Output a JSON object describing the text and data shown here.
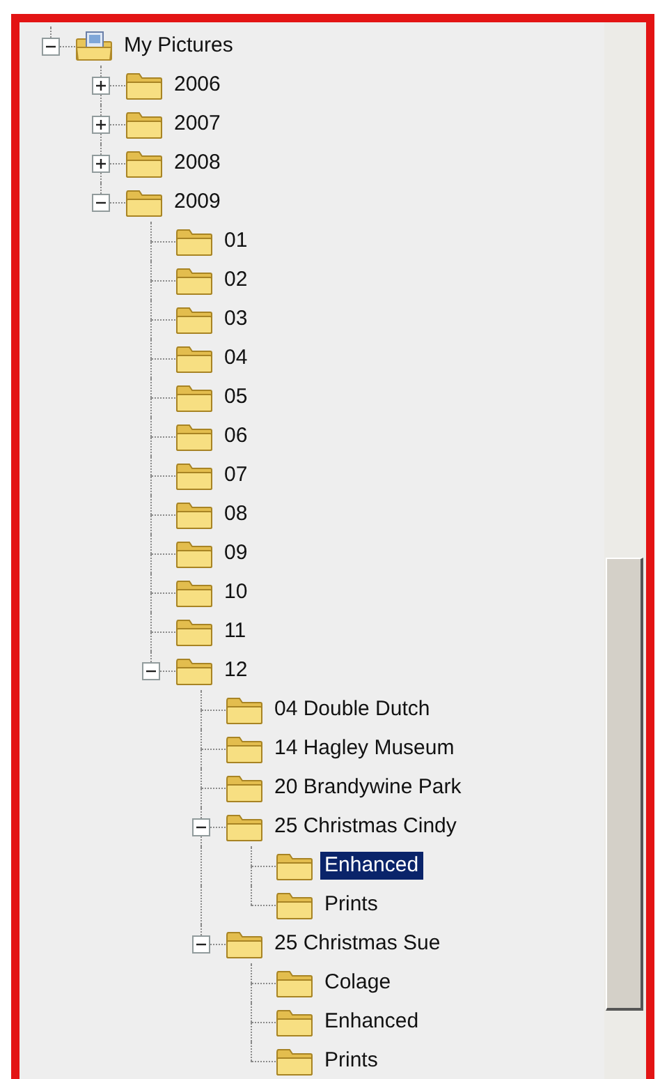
{
  "tree": {
    "items": [
      {
        "label": "My Pictures",
        "kind": "pictures",
        "expanded": true,
        "selected": false,
        "children": [
          {
            "label": "2006",
            "kind": "folder",
            "expanded": false,
            "selected": false
          },
          {
            "label": "2007",
            "kind": "folder",
            "expanded": false,
            "selected": false
          },
          {
            "label": "2008",
            "kind": "folder",
            "expanded": false,
            "selected": false
          },
          {
            "label": "2009",
            "kind": "folder",
            "expanded": true,
            "selected": false,
            "children": [
              {
                "label": "01",
                "kind": "folder",
                "selected": false
              },
              {
                "label": "02",
                "kind": "folder",
                "selected": false
              },
              {
                "label": "03",
                "kind": "folder",
                "selected": false
              },
              {
                "label": "04",
                "kind": "folder",
                "selected": false
              },
              {
                "label": "05",
                "kind": "folder",
                "selected": false
              },
              {
                "label": "06",
                "kind": "folder",
                "selected": false
              },
              {
                "label": "07",
                "kind": "folder",
                "selected": false
              },
              {
                "label": "08",
                "kind": "folder",
                "selected": false
              },
              {
                "label": "09",
                "kind": "folder",
                "selected": false
              },
              {
                "label": "10",
                "kind": "folder",
                "selected": false
              },
              {
                "label": "11",
                "kind": "folder",
                "selected": false
              },
              {
                "label": "12",
                "kind": "folder",
                "expanded": true,
                "selected": false,
                "children": [
                  {
                    "label": "04 Double Dutch",
                    "kind": "folder",
                    "selected": false
                  },
                  {
                    "label": "14 Hagley Museum",
                    "kind": "folder",
                    "selected": false
                  },
                  {
                    "label": "20 Brandywine Park",
                    "kind": "folder",
                    "selected": false
                  },
                  {
                    "label": "25 Christmas Cindy",
                    "kind": "folder",
                    "expanded": true,
                    "selected": false,
                    "children": [
                      {
                        "label": "Enhanced",
                        "kind": "folder",
                        "selected": true
                      },
                      {
                        "label": "Prints",
                        "kind": "folder",
                        "selected": false
                      }
                    ]
                  },
                  {
                    "label": "25 Christmas Sue",
                    "kind": "folder",
                    "expanded": true,
                    "selected": false,
                    "children": [
                      {
                        "label": "Colage",
                        "kind": "folder",
                        "selected": false
                      },
                      {
                        "label": "Enhanced",
                        "kind": "folder",
                        "selected": false
                      },
                      {
                        "label": "Prints",
                        "kind": "folder",
                        "selected": false
                      }
                    ]
                  }
                ]
              }
            ]
          }
        ]
      }
    ]
  }
}
